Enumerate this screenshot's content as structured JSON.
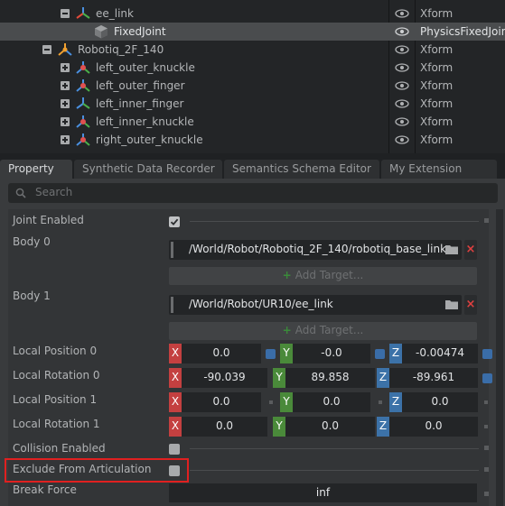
{
  "stage": {
    "rows": [
      {
        "name": "ee_link",
        "type": "Xform",
        "expander": "minus",
        "icon": "xform-axis-icon"
      },
      {
        "name": "FixedJoint",
        "type": "PhysicsFixedJoint",
        "expander": "none",
        "icon": "joint-cube-icon",
        "selected": true
      },
      {
        "name": "Robotiq_2F_140",
        "type": "Xform",
        "expander": "minus",
        "icon": "articulation-icon"
      },
      {
        "name": "left_outer_knuckle",
        "type": "Xform",
        "expander": "plus",
        "icon": "rigid-body-icon"
      },
      {
        "name": "left_outer_finger",
        "type": "Xform",
        "expander": "plus",
        "icon": "rigid-body-icon"
      },
      {
        "name": "left_inner_finger",
        "type": "Xform",
        "expander": "plus",
        "icon": "xform-axis-icon"
      },
      {
        "name": "left_inner_knuckle",
        "type": "Xform",
        "expander": "plus",
        "icon": "rigid-body-icon"
      },
      {
        "name": "right_outer_knuckle",
        "type": "Xform",
        "expander": "plus",
        "icon": "rigid-body-icon"
      }
    ]
  },
  "tabs": [
    "Property",
    "Synthetic Data Recorder",
    "Semantics Schema Editor",
    "My Extension"
  ],
  "search": {
    "placeholder": "Search"
  },
  "properties": {
    "joint_enabled": {
      "label": "Joint Enabled",
      "checked": true
    },
    "body0": {
      "label": "Body 0",
      "path": "/World/Robot/Robotiq_2F_140/robotiq_base_link",
      "add_target": "Add Target..."
    },
    "body1": {
      "label": "Body 1",
      "path": "/World/Robot/UR10/ee_link",
      "add_target": "Add Target..."
    },
    "local_position_0": {
      "label": "Local Position 0",
      "x": "0.0",
      "y": "-0.0",
      "z": "-0.00474"
    },
    "local_rotation_0": {
      "label": "Local Rotation 0",
      "x": "-90.039",
      "y": "89.858",
      "z": "-89.961"
    },
    "local_position_1": {
      "label": "Local Position 1",
      "x": "0.0",
      "y": "0.0",
      "z": "0.0"
    },
    "local_rotation_1": {
      "label": "Local Rotation 1",
      "x": "0.0",
      "y": "0.0",
      "z": "0.0"
    },
    "collision_enabled": {
      "label": "Collision Enabled",
      "checked": false
    },
    "exclude_from_articulation": {
      "label": "Exclude From Articulation",
      "checked": false
    },
    "break_force": {
      "label": "Break Force",
      "value": "inf"
    }
  },
  "axis_letters": {
    "x": "X",
    "y": "Y",
    "z": "Z"
  },
  "colors": {
    "axis_x": "#c44040",
    "axis_y": "#4a8a3a",
    "axis_z": "#3c72a8",
    "highlight": "#e02020",
    "selected_row": "#4a4c4e"
  }
}
